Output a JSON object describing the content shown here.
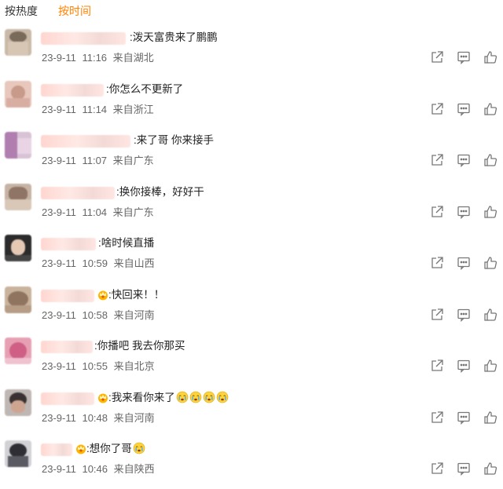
{
  "tabs": {
    "hot": "按热度",
    "time": "按时间"
  },
  "comments": [
    {
      "text": ":泼天富贵来了鹏鹏",
      "date": "23-9-11",
      "time": "11:16",
      "location": "来自湖北"
    },
    {
      "text": ":你怎么不更新了",
      "date": "23-9-11",
      "time": "11:14",
      "location": "来自浙江"
    },
    {
      "text": ":来了哥 你来接手",
      "date": "23-9-11",
      "time": "11:07",
      "location": "来自广东"
    },
    {
      "text": ":换你接棒，好好干",
      "date": "23-9-11",
      "time": "11:04",
      "location": "来自广东"
    },
    {
      "text": ":啥时候直播",
      "date": "23-9-11",
      "time": "10:59",
      "location": "来自山西"
    },
    {
      "text": ":快回来！！",
      "date": "23-9-11",
      "time": "10:58",
      "location": "来自河南"
    },
    {
      "text": ":你播吧 我去你那买",
      "date": "23-9-11",
      "time": "10:55",
      "location": "来自北京"
    },
    {
      "text": ":我来看你来了",
      "date": "23-9-11",
      "time": "10:48",
      "location": "来自河南"
    },
    {
      "text": ":想你了哥",
      "date": "23-9-11",
      "time": "10:46",
      "location": "来自陕西"
    }
  ],
  "icons": {
    "share": "share-icon",
    "comment": "comment-icon",
    "like": "thumb-up-icon",
    "badge": "fan-badge-icon",
    "emoji": "crying-emoji-icon"
  },
  "colors": {
    "active_tab": "#ff8200",
    "meta": "#666666",
    "icon": "#777777"
  }
}
